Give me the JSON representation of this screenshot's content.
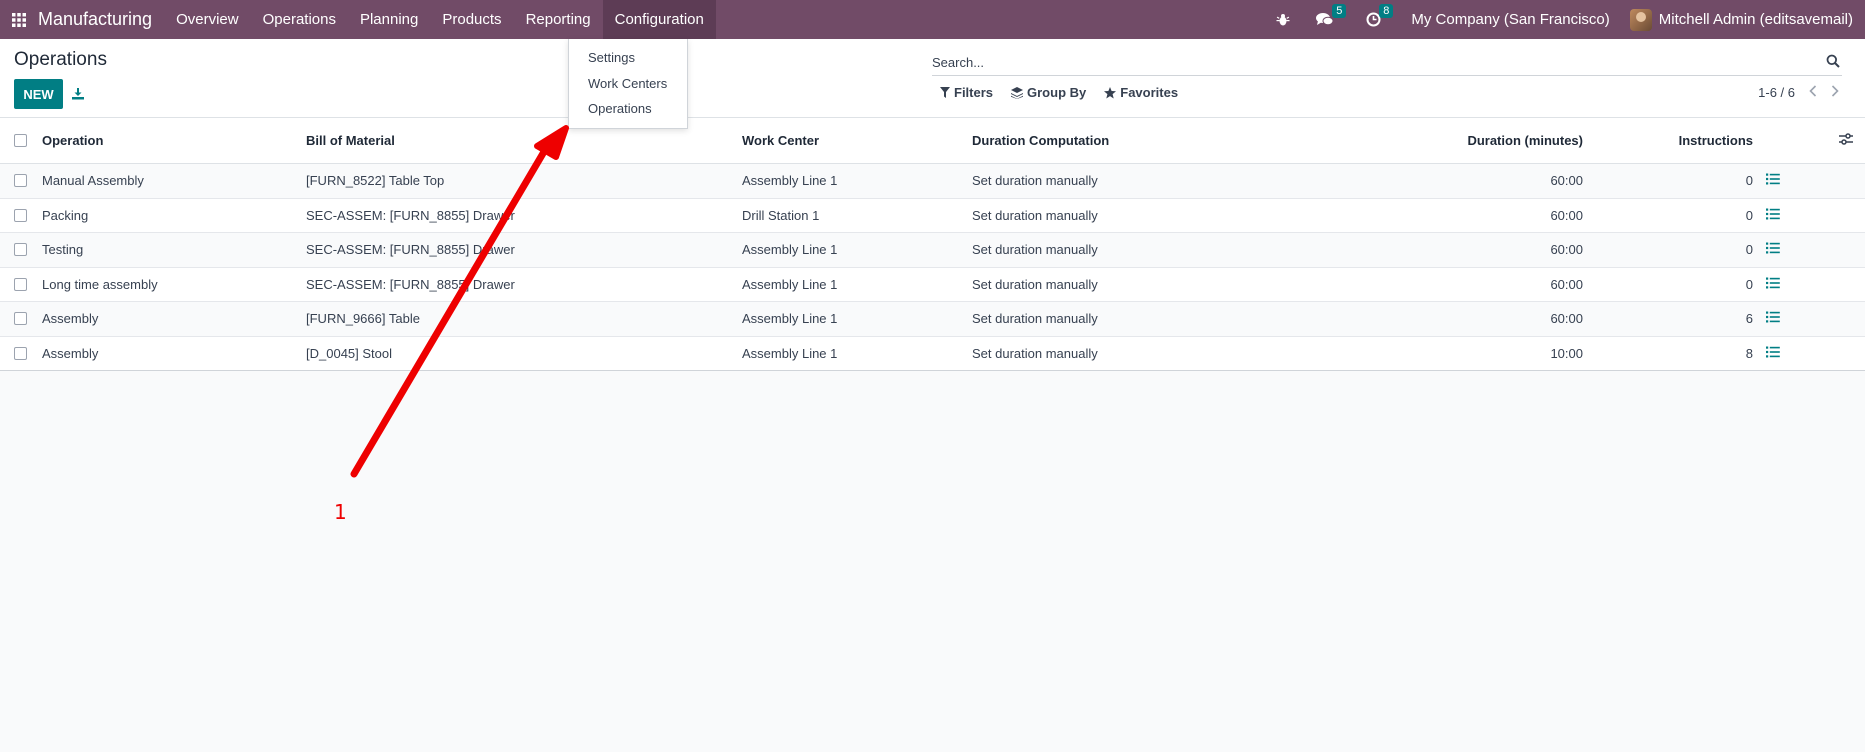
{
  "navbar": {
    "brand": "Manufacturing",
    "menu": [
      {
        "label": "Overview"
      },
      {
        "label": "Operations"
      },
      {
        "label": "Planning"
      },
      {
        "label": "Products"
      },
      {
        "label": "Reporting"
      },
      {
        "label": "Configuration"
      }
    ],
    "messages_count": "5",
    "activities_count": "8",
    "company": "My Company (San Francisco)",
    "user": "Mitchell Admin (editsavemail)"
  },
  "dropdown": {
    "items": [
      {
        "label": "Settings"
      },
      {
        "label": "Work Centers"
      },
      {
        "label": "Operations"
      }
    ]
  },
  "control": {
    "title": "Operations",
    "new_label": "NEW",
    "search_placeholder": "Search...",
    "filters_label": "Filters",
    "groupby_label": "Group By",
    "favorites_label": "Favorites",
    "pager": "1-6 / 6"
  },
  "table": {
    "headers": {
      "operation": "Operation",
      "bom": "Bill of Material",
      "work_center": "Work Center",
      "duration_computation": "Duration Computation",
      "duration": "Duration (minutes)",
      "instructions": "Instructions"
    },
    "rows": [
      {
        "operation": "Manual Assembly",
        "bom": "[FURN_8522] Table Top",
        "work_center": "Assembly Line 1",
        "duration_computation": "Set duration manually",
        "duration": "60:00",
        "instructions": "0"
      },
      {
        "operation": "Packing",
        "bom": "SEC-ASSEM: [FURN_8855] Drawer",
        "work_center": "Drill Station 1",
        "duration_computation": "Set duration manually",
        "duration": "60:00",
        "instructions": "0"
      },
      {
        "operation": "Testing",
        "bom": "SEC-ASSEM: [FURN_8855] Drawer",
        "work_center": "Assembly Line 1",
        "duration_computation": "Set duration manually",
        "duration": "60:00",
        "instructions": "0"
      },
      {
        "operation": "Long time assembly",
        "bom": "SEC-ASSEM: [FURN_8855] Drawer",
        "work_center": "Assembly Line 1",
        "duration_computation": "Set duration manually",
        "duration": "60:00",
        "instructions": "0"
      },
      {
        "operation": "Assembly",
        "bom": "[FURN_9666] Table",
        "work_center": "Assembly Line 1",
        "duration_computation": "Set duration manually",
        "duration": "60:00",
        "instructions": "6"
      },
      {
        "operation": "Assembly",
        "bom": "[D_0045] Stool",
        "work_center": "Assembly Line 1",
        "duration_computation": "Set duration manually",
        "duration": "10:00",
        "instructions": "8"
      }
    ]
  },
  "annotation": {
    "label": "1",
    "color": "#ee0000"
  },
  "colors": {
    "navbar": "#714B67",
    "primary": "#017e84"
  }
}
